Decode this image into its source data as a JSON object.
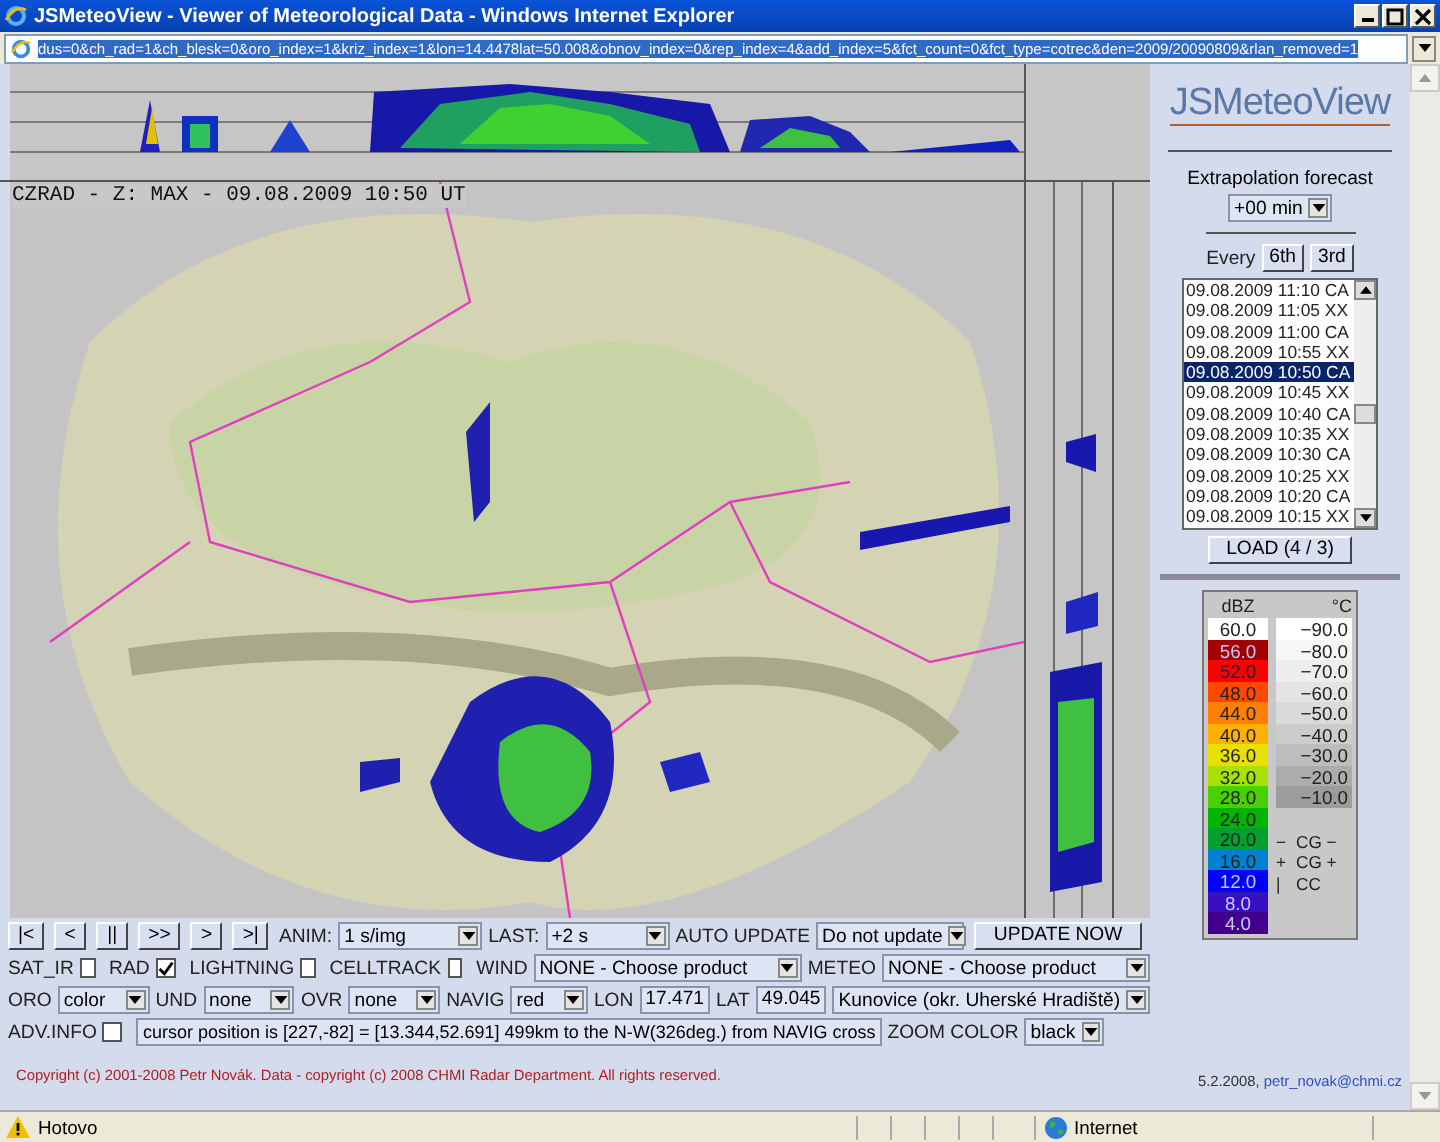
{
  "window": {
    "title": "JSMeteoView - Viewer of Meteorological Data - Windows Internet Explorer",
    "address": "dus=0&ch_rad=1&ch_blesk=0&oro_index=1&kriz_index=1&lon=14.4478lat=50.008&obnov_index=0&rep_index=4&add_index=5&fct_count=0&fct_type=cotrec&den=2009/20090809&rlan_removed=1"
  },
  "map": {
    "caption": "CZRAD - Z: MAX - 09.08.2009 10:50 UT"
  },
  "sidebar": {
    "logo": "JSMeteoView",
    "extrapolation_label": "Extrapolation forecast",
    "extrapolation_value": "+00 min",
    "every_label": "Every",
    "every_buttons": [
      {
        "label": "6th"
      },
      {
        "label": "3rd"
      }
    ],
    "times": [
      {
        "label": "09.08.2009 11:10 CA",
        "selected": false
      },
      {
        "label": "09.08.2009 11:05 XX",
        "selected": false
      },
      {
        "label": "09.08.2009 11:00 CA",
        "selected": false
      },
      {
        "label": "09.08.2009 10:55 XX",
        "selected": false
      },
      {
        "label": "09.08.2009 10:50 CA",
        "selected": true
      },
      {
        "label": "09.08.2009 10:45 XX",
        "selected": false
      },
      {
        "label": "09.08.2009 10:40 CA",
        "selected": false
      },
      {
        "label": "09.08.2009 10:35 XX",
        "selected": false
      },
      {
        "label": "09.08.2009 10:30 CA",
        "selected": false
      },
      {
        "label": "09.08.2009 10:25 XX",
        "selected": false
      },
      {
        "label": "09.08.2009 10:20 CA",
        "selected": false
      },
      {
        "label": "09.08.2009 10:15 XX",
        "selected": false
      }
    ],
    "load_button": "LOAD (4 / 3)"
  },
  "legend": {
    "dbz_title": "dBZ",
    "temp_title": "°C",
    "dbz": [
      {
        "label": "60.0",
        "color": "#ffffff"
      },
      {
        "label": "56.0",
        "color": "#a00000"
      },
      {
        "label": "52.0",
        "color": "#ff0000"
      },
      {
        "label": "48.0",
        "color": "#ff4800"
      },
      {
        "label": "44.0",
        "color": "#ff8000"
      },
      {
        "label": "40.0",
        "color": "#ffb000"
      },
      {
        "label": "36.0",
        "color": "#e8e000"
      },
      {
        "label": "32.0",
        "color": "#a8e000"
      },
      {
        "label": "28.0",
        "color": "#48d000"
      },
      {
        "label": "24.0",
        "color": "#00b400"
      },
      {
        "label": "20.0",
        "color": "#00a030"
      },
      {
        "label": "16.0",
        "color": "#0080d0"
      },
      {
        "label": "12.0",
        "color": "#0000ff"
      },
      {
        "label": "8.0",
        "color": "#3810c0"
      },
      {
        "label": "4.0",
        "color": "#40008c"
      }
    ],
    "temps": [
      {
        "label": "−90.0",
        "color": "#ffffff"
      },
      {
        "label": "−80.0",
        "color": "#f6f6f6"
      },
      {
        "label": "−70.0",
        "color": "#eeeeee"
      },
      {
        "label": "−60.0",
        "color": "#e4e4e4"
      },
      {
        "label": "−50.0",
        "color": "#dadada"
      },
      {
        "label": "−40.0",
        "color": "#cccccc"
      },
      {
        "label": "−30.0",
        "color": "#bdbdbd"
      },
      {
        "label": "−20.0",
        "color": "#acacac"
      },
      {
        "label": "−10.0",
        "color": "#9c9c9c"
      }
    ],
    "lightning": [
      {
        "mark": "−",
        "label": "CG −"
      },
      {
        "mark": "+",
        "label": "CG +"
      },
      {
        "mark": "|",
        "label": "CC"
      }
    ]
  },
  "controls": {
    "playback": [
      "|<",
      "<",
      "||",
      ">>",
      ">",
      ">|"
    ],
    "anim_label": "ANIM:",
    "anim_value": "1 s/img",
    "last_label": "LAST:",
    "last_value": "+2 s",
    "auto_label": "AUTO UPDATE",
    "auto_value": "Do not update",
    "update_button": "UPDATE NOW",
    "layers": [
      {
        "label": "SAT_IR",
        "checked": false
      },
      {
        "label": "RAD",
        "checked": true
      },
      {
        "label": "LIGHTNING",
        "checked": false
      },
      {
        "label": "CELLTRACK",
        "checked": false
      }
    ],
    "wind_label": "WIND",
    "wind_value": "NONE - Choose product",
    "meteo_label": "METEO",
    "meteo_value": "NONE - Choose product",
    "oro_label": "ORO",
    "oro_value": "color",
    "und_label": "UND",
    "und_value": "none",
    "ovr_label": "OVR",
    "ovr_value": "none",
    "navig_label": "NAVIG",
    "navig_value": "red",
    "lon_label": "LON",
    "lon_value": "17.471",
    "lat_label": "LAT",
    "lat_value": "49.045",
    "place_value": "Kunovice (okr. Uherské Hradiště)",
    "adv_label": "ADV.INFO",
    "adv_checked": false,
    "cursor_info": "cursor position is [227,-82] = [13.344,52.691]  499km to the N-W(326deg.) from NAVIG cross",
    "zoom_label": "ZOOM COLOR",
    "zoom_value": "black"
  },
  "footer": {
    "copyright": "Copyright (c) 2001-2008 Petr Novák. Data - copyright (c) 2008 CHMI Radar Department. All rights reserved.",
    "date": "5.2.2008,",
    "email": "petr_novak@chmi.cz"
  },
  "status_bar": {
    "text": "Hotovo",
    "zone": "Internet"
  }
}
